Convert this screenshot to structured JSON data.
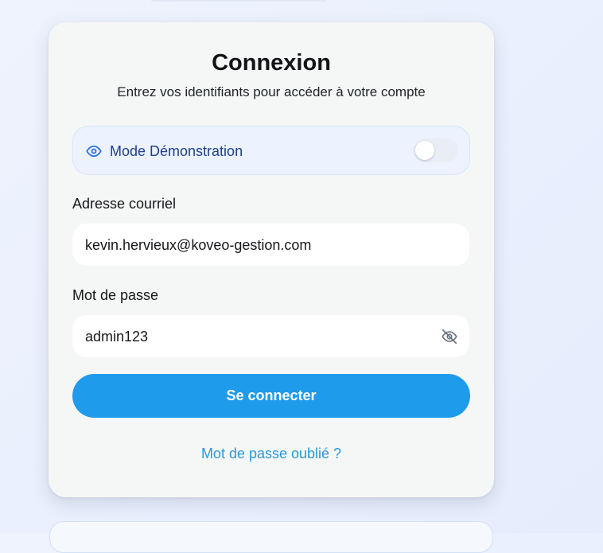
{
  "login": {
    "title": "Connexion",
    "subtitle": "Entrez vos identifiants pour accéder à votre compte",
    "demo": {
      "label": "Mode Démonstration",
      "enabled": false,
      "icon": "eye-icon"
    },
    "email": {
      "label": "Adresse courriel",
      "value": "kevin.hervieux@koveo-gestion.com"
    },
    "password": {
      "label": "Mot de passe",
      "value": "admin123",
      "visibility_icon": "eye-off-icon"
    },
    "submit_label": "Se connecter",
    "forgot_label": "Mot de passe oublié ?"
  },
  "colors": {
    "accent": "#1f9bec",
    "link": "#2a97dc",
    "demo_text": "#1e3f8a",
    "demo_background": "#ecf3fe",
    "card_background": "#f5f7f6"
  }
}
